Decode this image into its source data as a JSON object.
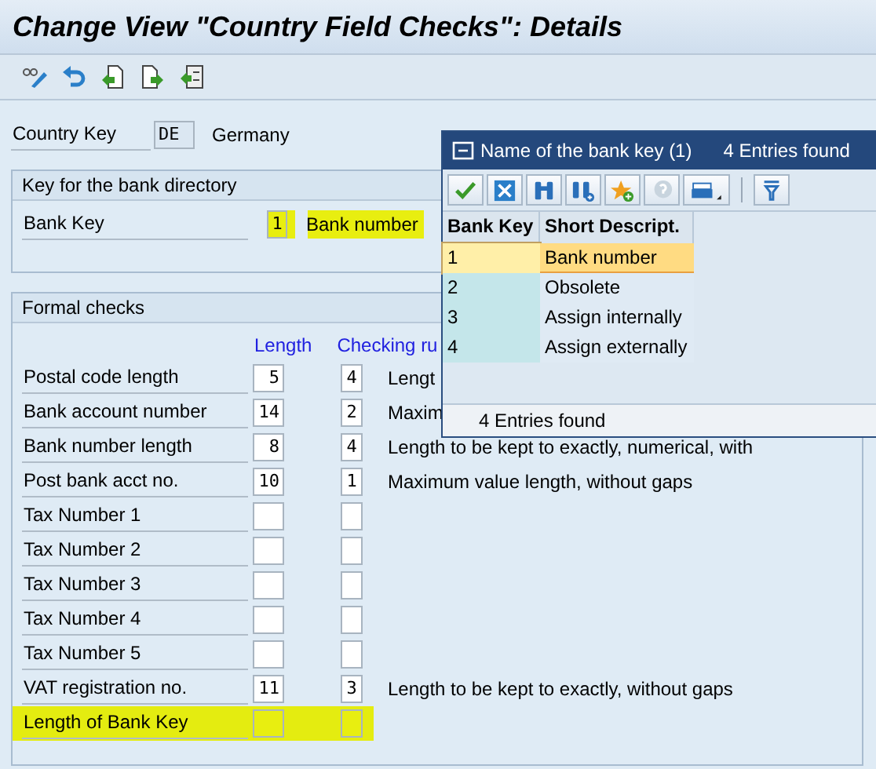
{
  "title": "Change View \"Country Field Checks\": Details",
  "country": {
    "label": "Country Key",
    "value": "DE",
    "name": "Germany"
  },
  "bank_directory": {
    "title": "Key for the bank directory",
    "label": "Bank Key",
    "value": "1",
    "description": "Bank number",
    "highlighted": true
  },
  "formal_checks": {
    "title": "Formal checks",
    "columns": [
      "Length",
      "Checking ru"
    ],
    "rows": [
      {
        "label": "Postal code length",
        "length": "5",
        "rule": "4",
        "description": "Lengt",
        "highlighted": false
      },
      {
        "label": "Bank account number",
        "length": "14",
        "rule": "2",
        "description": "Maxim",
        "highlighted": false
      },
      {
        "label": "Bank number length",
        "length": "8",
        "rule": "4",
        "description": "Length to be kept to exactly, numerical, with",
        "highlighted": false
      },
      {
        "label": "Post bank acct no.",
        "length": "10",
        "rule": "1",
        "description": "Maximum value length, without gaps",
        "highlighted": false
      },
      {
        "label": "Tax Number 1",
        "highlighted": false
      },
      {
        "label": "Tax Number 2",
        "highlighted": false
      },
      {
        "label": "Tax Number 3",
        "highlighted": false
      },
      {
        "label": "Tax Number 4",
        "highlighted": false
      },
      {
        "label": "Tax Number 5",
        "highlighted": false
      },
      {
        "label": "VAT registration no.",
        "length": "11",
        "rule": "3",
        "description": "Length to be kept to exactly, without gaps",
        "highlighted": false
      },
      {
        "label": "Length of Bank Key",
        "highlighted": true
      }
    ]
  },
  "dialog": {
    "title": "Name of the bank key (1)",
    "count": "4 Entries found",
    "columns": [
      "Bank Key",
      "Short Descript."
    ],
    "rows": [
      {
        "key": "1",
        "text": "Bank number",
        "selected": true
      },
      {
        "key": "2",
        "text": "Obsolete",
        "selected": false
      },
      {
        "key": "3",
        "text": "Assign internally",
        "selected": false
      },
      {
        "key": "4",
        "text": "Assign externally",
        "selected": false
      }
    ],
    "status": "4 Entries found"
  }
}
